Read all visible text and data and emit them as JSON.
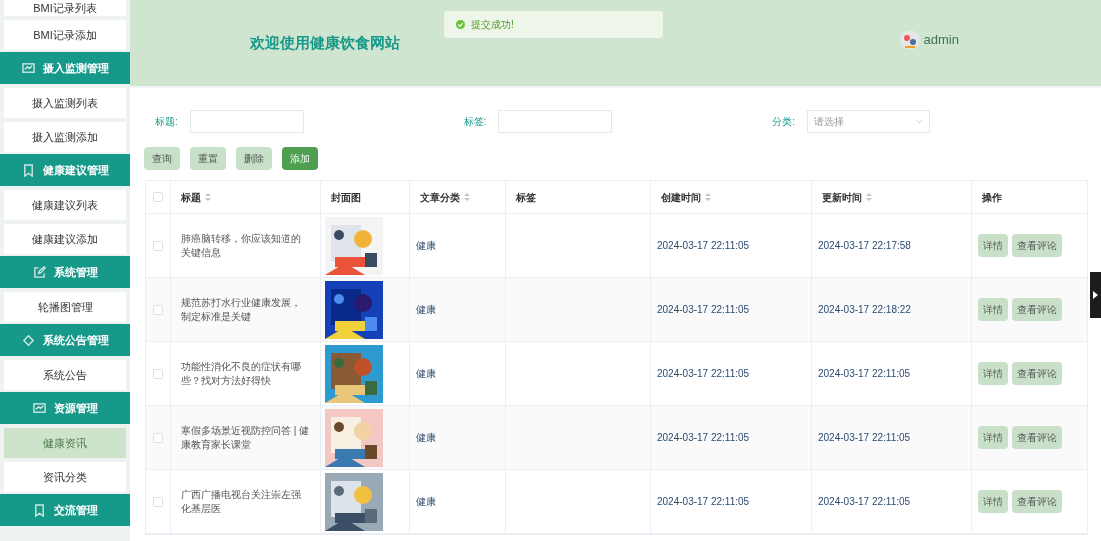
{
  "sidebar": {
    "items": [
      {
        "kind": "link",
        "label": "BMI记录列表",
        "selected": false
      },
      {
        "kind": "link",
        "label": "BMI记录添加",
        "selected": false
      },
      {
        "kind": "group",
        "label": "摄入监测管理"
      },
      {
        "kind": "link",
        "label": "摄入监测列表",
        "selected": false
      },
      {
        "kind": "link",
        "label": "摄入监测添加",
        "selected": false
      },
      {
        "kind": "group",
        "label": "健康建议管理"
      },
      {
        "kind": "link",
        "label": "健康建议列表",
        "selected": false
      },
      {
        "kind": "link",
        "label": "健康建议添加",
        "selected": false
      },
      {
        "kind": "group",
        "label": "系统管理"
      },
      {
        "kind": "link",
        "label": "轮播图管理",
        "selected": false
      },
      {
        "kind": "group",
        "label": "系统公告管理"
      },
      {
        "kind": "link",
        "label": "系统公告",
        "selected": false
      },
      {
        "kind": "group",
        "label": "资源管理"
      },
      {
        "kind": "link",
        "label": "健康资讯",
        "selected": true
      },
      {
        "kind": "link",
        "label": "资讯分类",
        "selected": false
      },
      {
        "kind": "group",
        "label": "交流管理"
      }
    ]
  },
  "header": {
    "title": "欢迎使用健康饮食网站",
    "user": "admin"
  },
  "toast": {
    "kind": "success",
    "message": "提交成功!"
  },
  "filters": [
    {
      "label": "标题:",
      "kind": "input"
    },
    {
      "label": "标签:",
      "kind": "input"
    },
    {
      "label": "分类:",
      "kind": "select",
      "placeholder": "请选择"
    }
  ],
  "actions": [
    {
      "label": "查询",
      "hovered": false
    },
    {
      "label": "重置",
      "hovered": false
    },
    {
      "label": "删除",
      "hovered": false
    },
    {
      "label": "添加",
      "hovered": true
    }
  ],
  "table": {
    "select_all_checked": false,
    "columns": [
      {
        "label": "标题",
        "sortable": true
      },
      {
        "label": "封面图",
        "sortable": false
      },
      {
        "label": "文章分类",
        "sortable": true
      },
      {
        "label": "标签",
        "sortable": false
      },
      {
        "label": "创建时间",
        "sortable": true
      },
      {
        "label": "更新时间",
        "sortable": true
      },
      {
        "label": "操作",
        "sortable": false
      }
    ],
    "rows": [
      {
        "checked": false,
        "title": "肺癌脑转移，你应该知道的关键信息",
        "cover": {
          "kind": "picture"
        },
        "category": "健康",
        "created": "2024-03-17 22:11:05",
        "updated": "2024-03-17 22:17:58",
        "buttons": [
          "详情",
          "查看评论"
        ]
      },
      {
        "checked": false,
        "title": "规范苏打水行业健康发展，制定标准是关键",
        "cover": {
          "kind": "picture"
        },
        "category": "健康",
        "created": "2024-03-17 22:11:05",
        "updated": "2024-03-17 22:18:22",
        "buttons": [
          "详情",
          "查看评论"
        ]
      },
      {
        "checked": false,
        "title": "功能性消化不良的症状有哪些？找对方法好得快",
        "cover": {
          "kind": "picture"
        },
        "category": "健康",
        "created": "2024-03-17 22:11:05",
        "updated": "2024-03-17 22:11:05",
        "buttons": [
          "详情",
          "查看评论"
        ]
      },
      {
        "checked": false,
        "title": "寒假多场景近视防控问答 | 健康教育家长课堂",
        "cover": {
          "kind": "picture"
        },
        "category": "健康",
        "created": "2024-03-17 22:11:05",
        "updated": "2024-03-17 22:11:05",
        "buttons": [
          "详情",
          "查看评论"
        ]
      },
      {
        "checked": false,
        "title": "广西广播电视台关注崇左强化基层医",
        "cover": {
          "kind": "picture"
        },
        "category": "健康",
        "created": "2024-03-17 22:11:05",
        "updated": "2024-03-17 22:11:05",
        "buttons": [
          "详情",
          "查看评论"
        ]
      }
    ]
  }
}
